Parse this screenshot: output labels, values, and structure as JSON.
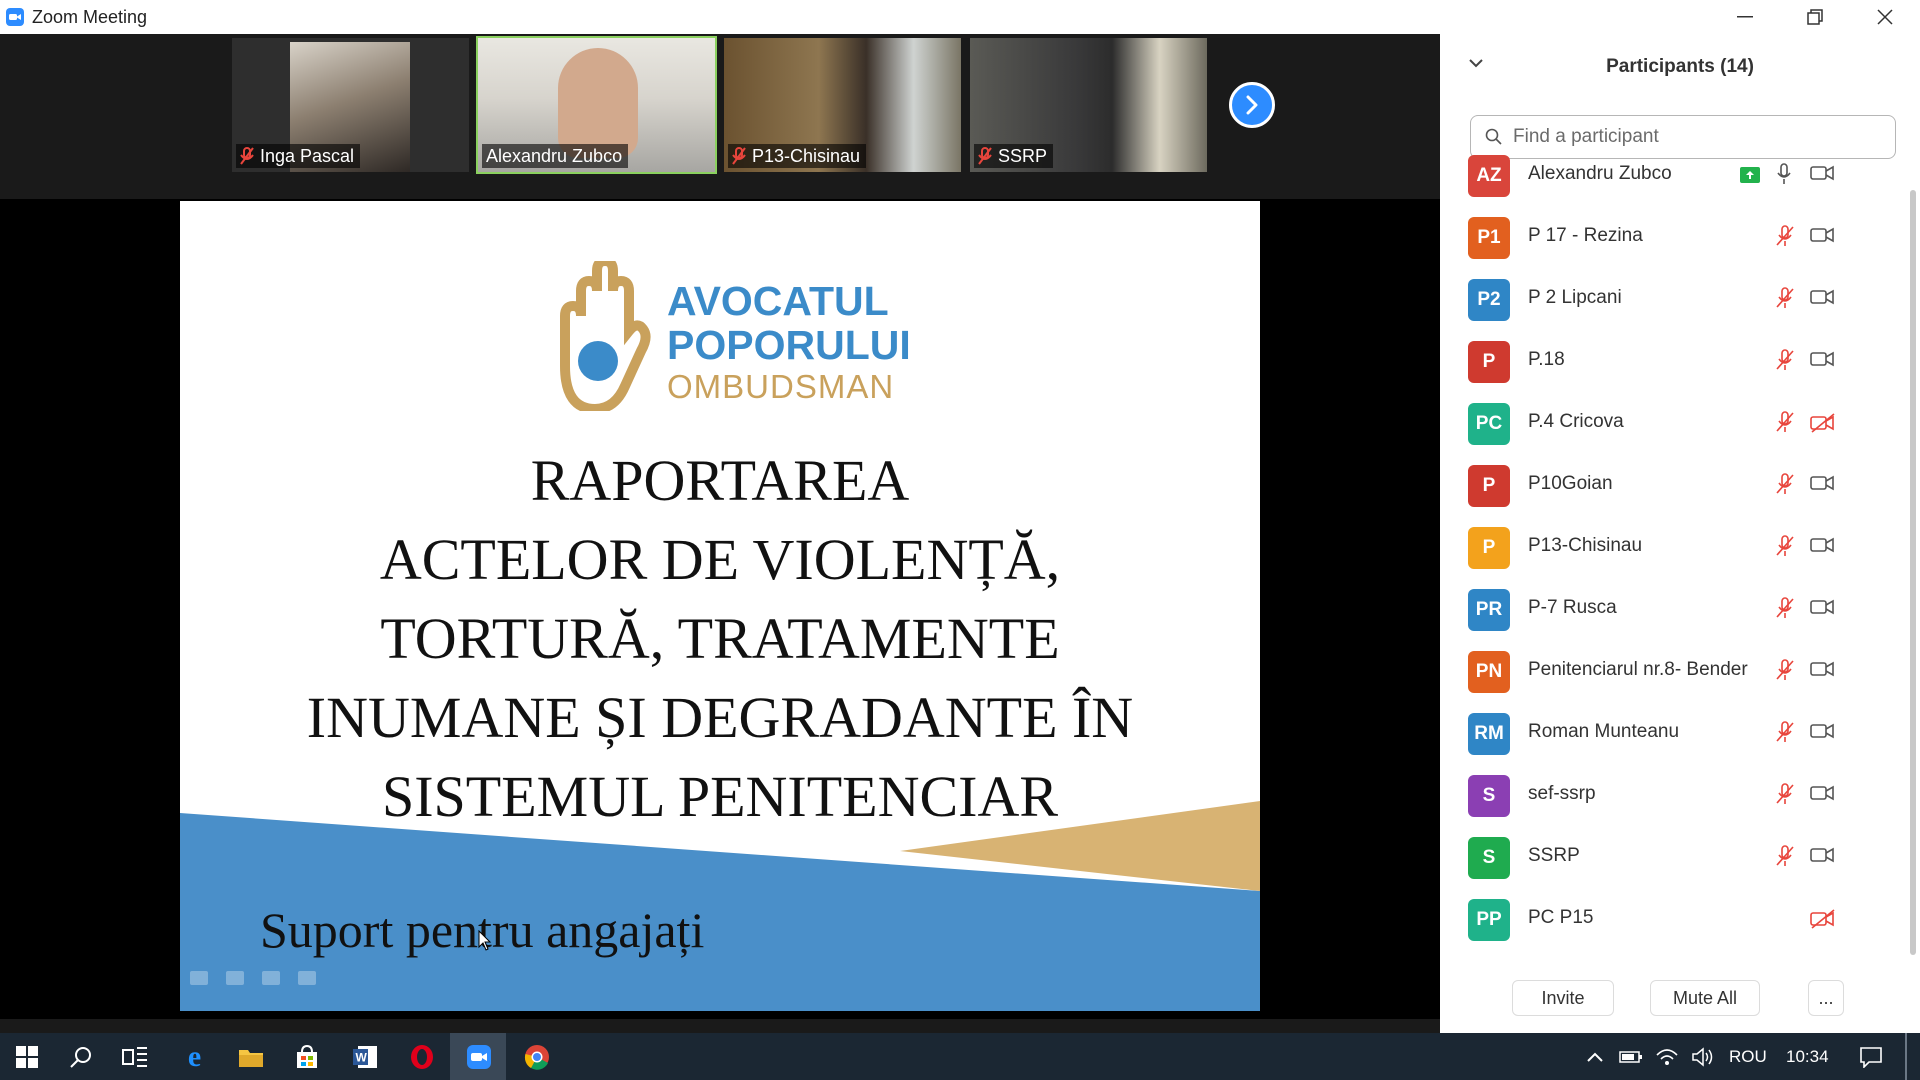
{
  "window": {
    "title": "Zoom Meeting"
  },
  "video_strip": {
    "tiles": [
      {
        "name": "Inga Pascal",
        "muted": true
      },
      {
        "name": "Alexandru Zubco",
        "muted": false,
        "active_speaker": true
      },
      {
        "name": "P13-Chisinau",
        "muted": true
      },
      {
        "name": "SSRP",
        "muted": true
      }
    ]
  },
  "slide": {
    "logo_line1": "AVOCATUL",
    "logo_line2": "POPORULUI",
    "logo_line3": "OMBUDSMAN",
    "title_lines": [
      "RAPORTAREA",
      "ACTELOR DE VIOLENȚĂ,",
      "TORTURĂ, TRATAMENTE",
      "INUMANE ȘI DEGRADANTE ÎN",
      "SISTEMUL PENITENCIAR"
    ],
    "subtitle": "Suport pentru angajați",
    "colors": {
      "blue": "#4a8fc9",
      "gold": "#d8b373"
    }
  },
  "participants_panel": {
    "title": "Participants (14)",
    "search_placeholder": "Find a participant",
    "participants": [
      {
        "initials": "AZ",
        "name": "Alexandru Zubco",
        "color": "#d9453b",
        "mic": "on",
        "video": "off",
        "sharing": true
      },
      {
        "initials": "P1",
        "name": "P 17 - Rezina",
        "color": "#e2601f",
        "mic": "muted",
        "video": "off"
      },
      {
        "initials": "P2",
        "name": "P 2 Lipcani",
        "color": "#2f86c6",
        "mic": "muted",
        "video": "off"
      },
      {
        "initials": "P",
        "name": "P.18",
        "color": "#cf3a2f",
        "mic": "muted",
        "video": "off"
      },
      {
        "initials": "PC",
        "name": "P.4 Cricova",
        "color": "#1fb28a",
        "mic": "muted",
        "video": "disabled"
      },
      {
        "initials": "P",
        "name": "P10Goian",
        "color": "#cf3a2f",
        "mic": "muted",
        "video": "off"
      },
      {
        "initials": "P",
        "name": "P13-Chisinau",
        "color": "#f3a21c",
        "mic": "muted",
        "video": "off"
      },
      {
        "initials": "PR",
        "name": "P-7 Rusca",
        "color": "#2f86c6",
        "mic": "muted",
        "video": "off"
      },
      {
        "initials": "PN",
        "name": "Penitenciarul nr.8- Bender",
        "color": "#e2601f",
        "mic": "muted",
        "video": "off"
      },
      {
        "initials": "RM",
        "name": "Roman Munteanu",
        "color": "#2f86c6",
        "mic": "muted",
        "video": "off"
      },
      {
        "initials": "S",
        "name": "sef-ssrp",
        "color": "#8b3fb3",
        "mic": "muted",
        "video": "off"
      },
      {
        "initials": "S",
        "name": "SSRP",
        "color": "#1fab4f",
        "mic": "muted",
        "video": "off"
      },
      {
        "initials": "PP",
        "name": "PC P15",
        "color": "#1fb28a",
        "mic": "none",
        "video": "disabled"
      }
    ],
    "buttons": {
      "invite": "Invite",
      "mute_all": "Mute All",
      "more": "..."
    }
  },
  "taskbar": {
    "language": "ROU",
    "time": "10:34",
    "apps": [
      "start-icon",
      "search-icon",
      "task-view-icon",
      "edge-icon",
      "file-explorer-icon",
      "store-icon",
      "word-icon",
      "opera-icon",
      "zoom-icon",
      "chrome-icon"
    ]
  }
}
